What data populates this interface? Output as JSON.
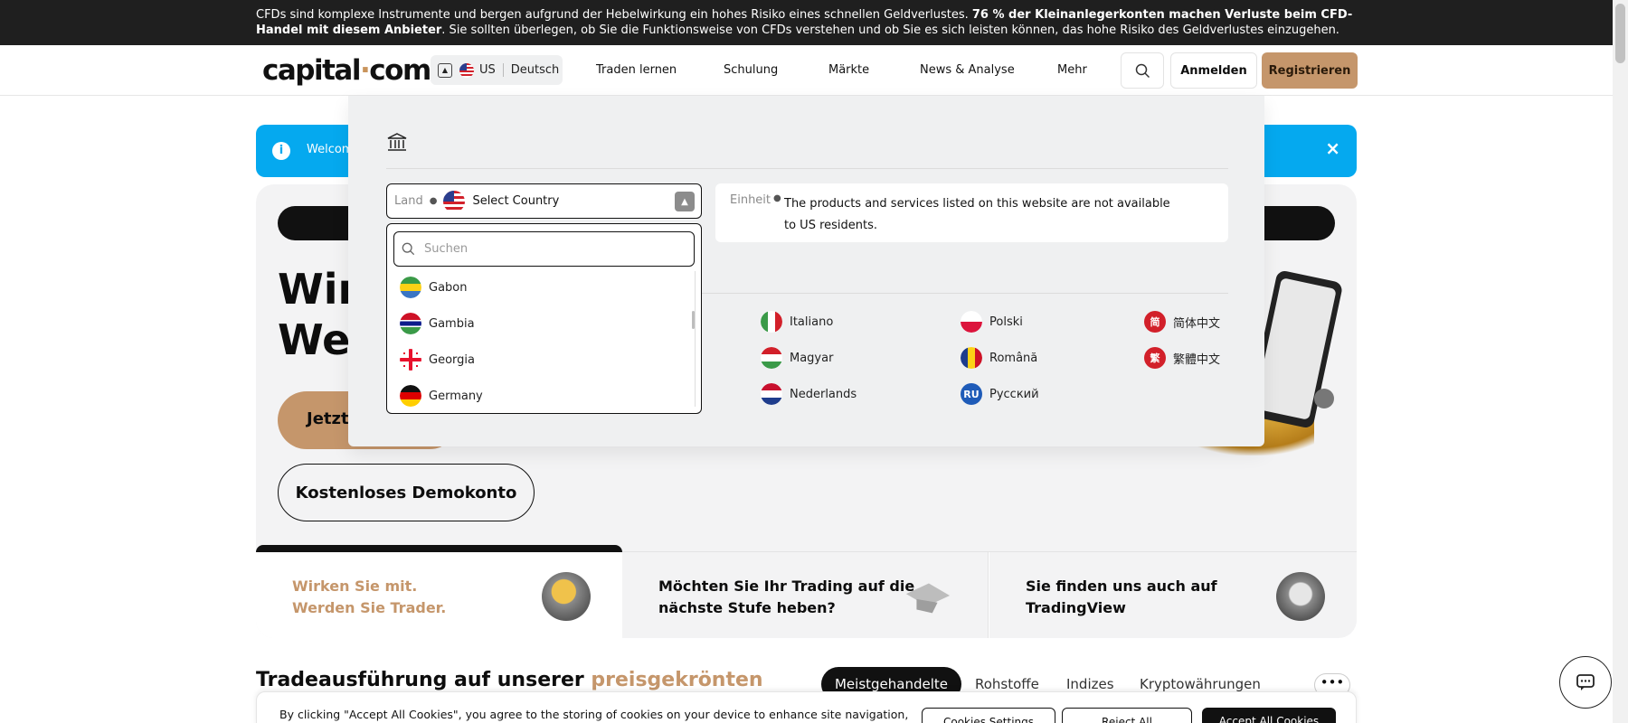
{
  "risk_warning": {
    "text_pre": "CFDs sind komplexe Instrumente und bergen aufgrund der Hebelwirkung ein hohes Risiko eines schnellen Geldverlustes. ",
    "text_bold": "76 % der Kleinanlegerkonten machen Verluste beim CFD-Handel mit diesem Anbieter",
    "text_post": ". Sie sollten überlegen, ob Sie die Funktionsweise von CFDs verstehen und ob Sie es sich leisten können, das hohe Risiko des Geldverlustes einzugehen."
  },
  "header": {
    "logo_left": "capital",
    "logo_dot": "·",
    "logo_right": "com",
    "region": "US",
    "language": "Deutsch",
    "nav": [
      "Traden lernen",
      "Schulung",
      "Märkte",
      "News & Analyse",
      "Mehr"
    ],
    "login": "Anmelden",
    "register": "Registrieren"
  },
  "welcome": {
    "text": "Welcom",
    "close": "×"
  },
  "hero": {
    "headline_line1": "Wir",
    "headline_line2": "We",
    "cta_primary": "Jetzt",
    "cta_secondary": "Kostenloses Demokonto"
  },
  "cards": [
    {
      "line1": "Wirken Sie mit.",
      "line2": "Werden Sie Trader."
    },
    {
      "line1": "Möchten Sie Ihr Trading auf die",
      "line2": "nächste Stufe heben?"
    },
    {
      "line1": "Sie finden uns auch auf",
      "line2": "TradingView"
    }
  ],
  "section": {
    "title_plain": "Tradeausführung auf unserer ",
    "title_accent": "preisgekrönten"
  },
  "tabs": [
    "Meistgehandelte",
    "Rohstoffe",
    "Indizes",
    "Kryptowährungen"
  ],
  "more_tabs": "•••",
  "cookie": {
    "text": "By clicking \"Accept All Cookies\", you agree to the storing of cookies on your device to enhance site navigation,",
    "settings": "Cookies Settings",
    "reject": "Reject All",
    "accept": "Accept All Cookies"
  },
  "overlay": {
    "country_label": "Land",
    "country_placeholder": "Select Country",
    "unit_label": "Einheit",
    "unit_text": "The products and services listed on this website are not available to US residents.",
    "search_placeholder": "Suchen",
    "countries": [
      "Gabon",
      "Gambia",
      "Georgia",
      "Germany"
    ],
    "languages": [
      {
        "name": "Italiano",
        "icon": "italy-flag"
      },
      {
        "name": "Magyar",
        "icon": "hungary-flag"
      },
      {
        "name": "Nederlands",
        "icon": "netherlands-flag"
      },
      {
        "name": "Polski",
        "icon": "poland-flag"
      },
      {
        "name": "Română",
        "icon": "romania-flag"
      },
      {
        "name": "Русский",
        "badge": "RU"
      },
      {
        "name": "简体中文",
        "badge": "简"
      },
      {
        "name": "繁體中文",
        "badge": "繁"
      }
    ]
  },
  "colors": {
    "brand_accent": "#c5966b",
    "welcome_blue": "#05a9ef",
    "risk_bar_bg": "#1f1f1f"
  }
}
